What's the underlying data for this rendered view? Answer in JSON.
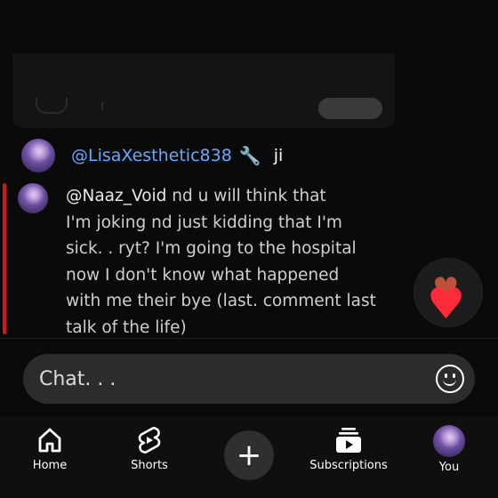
{
  "pinned": {
    "handle": "@LisaXesthetic838",
    "wrench_icon": "wrench-icon",
    "text": "ji"
  },
  "reply": {
    "mention": "@Naaz_Void",
    "lines": [
      "nd u will think that",
      "I'm joking nd just kidding that I'm",
      "sick. . ryt?  I'm going to the hospital",
      "now I don't know what happened",
      "with me their bye (last.  comment last",
      "talk of the life)"
    ]
  },
  "chat": {
    "placeholder": "Chat. . .",
    "value": "",
    "emoji_icon": "smiley-icon"
  },
  "nav": {
    "home": "Home",
    "shorts": "Shorts",
    "create_icon": "plus-icon",
    "subscriptions": "Subscriptions",
    "you": "You"
  },
  "colors": {
    "background": "#0a0a0a",
    "handle_blue": "#66a8ff",
    "pin_bar_red": "#d8141c",
    "heart_red": "#ff2a3a"
  }
}
